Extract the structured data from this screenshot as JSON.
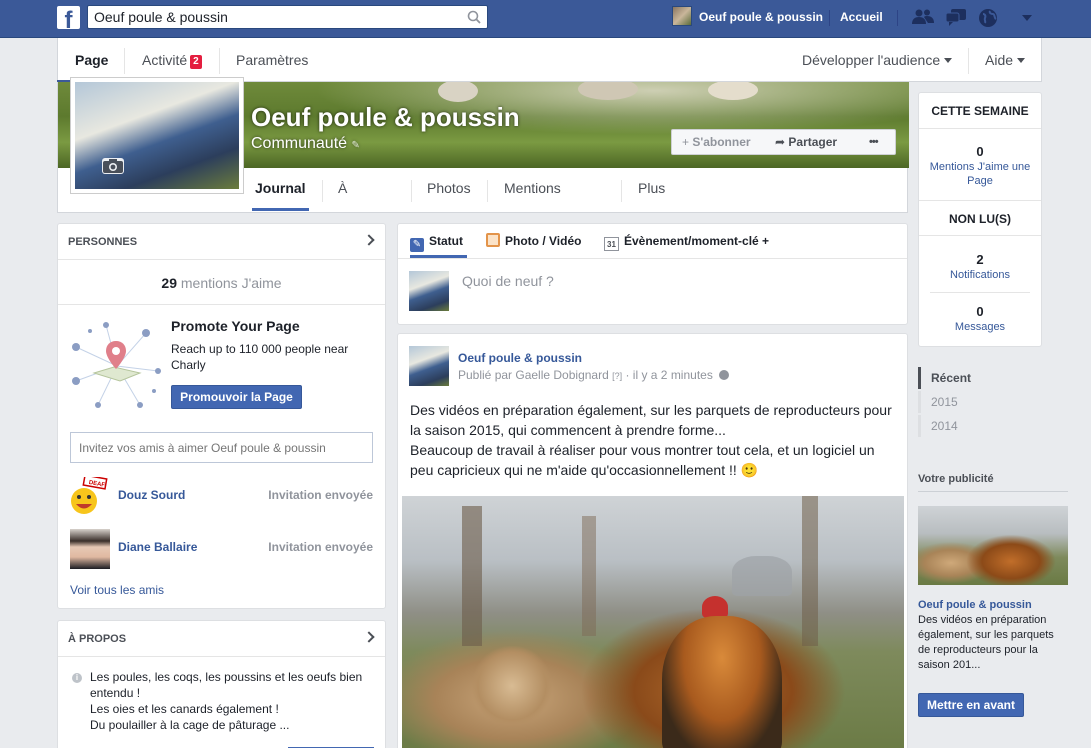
{
  "topbar": {
    "search_value": "Oeuf poule & poussin",
    "profile_name": "Oeuf poule & poussin",
    "home_label": "Accueil"
  },
  "pagebar": {
    "tabs": [
      {
        "label": "Page"
      },
      {
        "label": "Activité",
        "badge": "2"
      },
      {
        "label": "Paramètres"
      }
    ],
    "audience_label": "Développer l'audience",
    "help_label": "Aide"
  },
  "cover": {
    "title": "Oeuf poule & poussin",
    "category": "Communauté",
    "subscribe_label": "S'abonner",
    "share_label": "Partager",
    "more_label": "•••",
    "tabs": [
      "Journal",
      "À propos",
      "Photos",
      "Mentions J'aime",
      "Plus"
    ]
  },
  "people": {
    "header": "PERSONNES",
    "likes_count": "29",
    "likes_label": "mentions J'aime",
    "promote_title": "Promote Your Page",
    "promote_text": "Reach up to 110 000 people near Charly",
    "promote_button": "Promouvoir la Page",
    "invite_placeholder": "Invitez vos amis à aimer Oeuf poule & poussin",
    "friends": [
      {
        "name": "Douz Sourd",
        "status": "Invitation envoyée"
      },
      {
        "name": "Diane Ballaire",
        "status": "Invitation envoyée"
      }
    ],
    "see_all": "Voir tous les amis"
  },
  "about": {
    "header": "À PROPOS",
    "text": "Les poules, les coqs, les poussins et les oeufs bien entendu !\nLes oies et les canards également !\nDu poulailler à la cage de pâturage ..."
  },
  "composer": {
    "tabs": [
      "Statut",
      "Photo / Vidéo",
      "Évènement/moment-clé +"
    ],
    "placeholder": "Quoi de neuf ?"
  },
  "post": {
    "author": "Oeuf poule & poussin",
    "meta_published": "Publié par Gaelle Dobignard",
    "meta_q": "[?]",
    "meta_time": "· il y a 2 minutes",
    "text_line1": "Des vidéos en préparation également, sur les parquets de reproducteurs pour la saison 2015, qui commencent à prendre forme...",
    "text_line2": "Beaucoup de travail à réaliser pour vous montrer tout cela, et un logiciel un peu capricieux qui ne m'aide qu'occasionnellement !! 🙂"
  },
  "this_week": {
    "header": "CETTE SEMAINE",
    "likes_value": "0",
    "likes_label": "Mentions J'aime une Page",
    "unread_header": "NON LU(S)",
    "notif_value": "2",
    "notif_label": "Notifications",
    "msg_value": "0",
    "msg_label": "Messages"
  },
  "timeline_years": [
    "Récent",
    "2015",
    "2014"
  ],
  "ad": {
    "header": "Votre publicité",
    "title": "Oeuf poule & poussin",
    "text": "Des vidéos en préparation également, sur les parquets de reproducteurs pour la saison 201...",
    "button": "Mettre en avant"
  },
  "colors": {
    "brand_blue": "#3b5998",
    "link_blue": "#365899",
    "badge_red": "#e41e3f"
  }
}
